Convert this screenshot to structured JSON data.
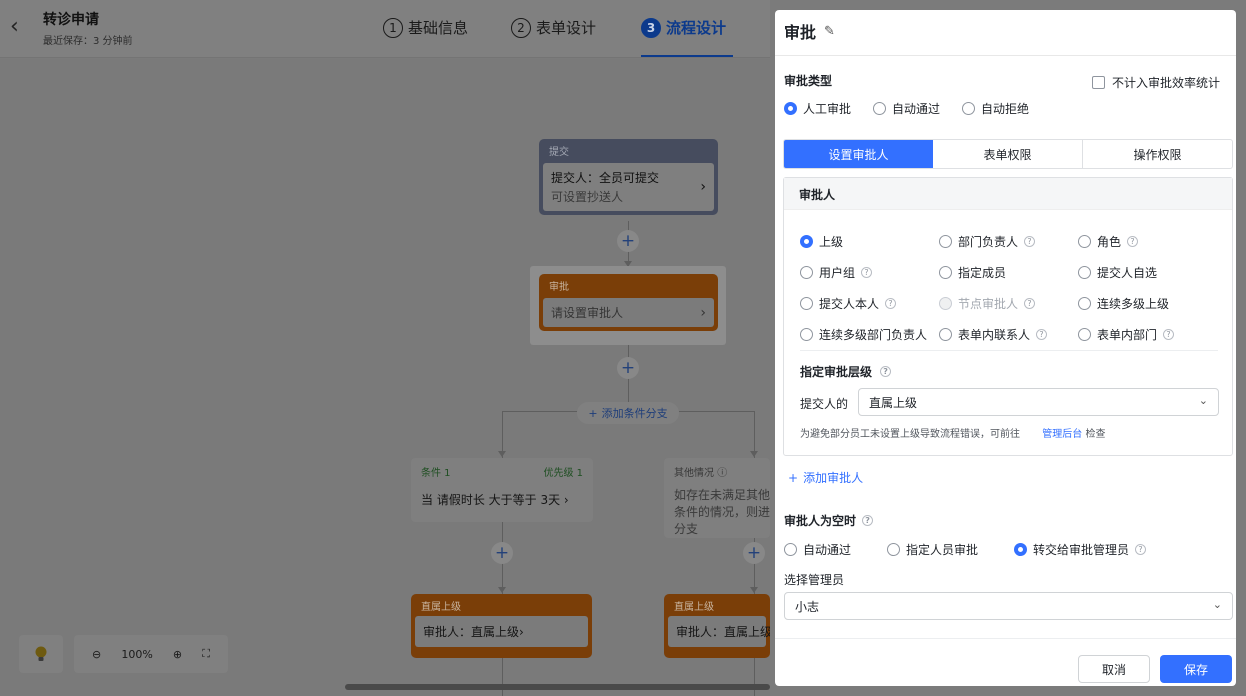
{
  "header": {
    "back_icon": "chevron-left-icon",
    "title": "转诊申请",
    "save_note": "最近保存：3 分钟前",
    "steps": [
      {
        "num": "1",
        "label": "基础信息"
      },
      {
        "num": "2",
        "label": "表单设计"
      },
      {
        "num": "3",
        "label": "流程设计"
      }
    ],
    "active_step": 3
  },
  "flow": {
    "submit_node": {
      "title": "提交",
      "line1": "提交人：全员可提交",
      "line2": "可设置抄送人"
    },
    "approve_node": {
      "title": "审批",
      "body": "请设置审批人"
    },
    "add_branch": "添加条件分支",
    "cond_a": {
      "name": "条件 1",
      "priority": "优先级 1",
      "text": "当 请假时长 大于等于 3天"
    },
    "cond_b": {
      "name": "其他情况",
      "text": "如存在未满足其他分支条件的情况，则进入此分支"
    },
    "level_a": {
      "title": "直属上级",
      "body": "审批人：直属上级"
    },
    "level_b": {
      "title": "直属上级",
      "body": "审批人：直属上级"
    },
    "zoom": "100%",
    "colors": {
      "approve": "#e6741a",
      "submit": "#6d7a99",
      "accent": "#3370ff"
    }
  },
  "drawer": {
    "title": "审批",
    "type_label": "审批类型",
    "type_options": [
      "人工审批",
      "自动通过",
      "自动拒绝"
    ],
    "checkbox_label": "不计入审批效率统计",
    "tabs": [
      "设置审批人",
      "表单权限",
      "操作权限"
    ],
    "approver_label": "审批人",
    "approver_options": [
      [
        "上级",
        "部门负责人",
        "角色"
      ],
      [
        "用户组",
        "指定成员",
        "提交人自选"
      ],
      [
        "提交人本人",
        "节点审批人",
        "连续多级上级"
      ],
      [
        "连续多级部门负责人",
        "表单内联系人",
        "表单内部门"
      ]
    ],
    "level_label": "指定审批层级",
    "submitter_of": "提交人的",
    "level_value": "直属上级",
    "hint_prefix": "为避免部分员工未设置上级导致流程错误，可前往",
    "hint_link": "管理后台",
    "hint_suffix": "检查",
    "add_approver": "添加审批人",
    "empty_label": "审批人为空时",
    "empty_options": [
      "自动通过",
      "指定人员审批",
      "转交给审批管理员"
    ],
    "manager_label": "选择管理员",
    "manager_value": "小志",
    "cancel": "取消",
    "save": "保存"
  }
}
